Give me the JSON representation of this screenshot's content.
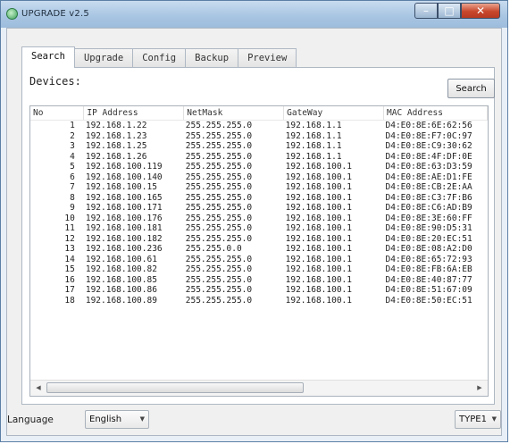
{
  "window": {
    "title": "UPGRADE v2.5",
    "minimize": "–",
    "maximize": "□",
    "close": "✕"
  },
  "tabs": [
    "Search",
    "Upgrade",
    "Config",
    "Backup",
    "Preview"
  ],
  "active_tab": "Search",
  "devices_label": "Devices:",
  "search_button": "Search",
  "table": {
    "columns": [
      "No",
      "IP Address",
      "NetMask",
      "GateWay",
      "MAC Address"
    ],
    "rows": [
      [
        "1",
        "192.168.1.22",
        "255.255.255.0",
        "192.168.1.1",
        "D4:E0:8E:6E:62:56"
      ],
      [
        "2",
        "192.168.1.23",
        "255.255.255.0",
        "192.168.1.1",
        "D4:E0:8E:F7:0C:97"
      ],
      [
        "3",
        "192.168.1.25",
        "255.255.255.0",
        "192.168.1.1",
        "D4:E0:8E:C9:30:62"
      ],
      [
        "4",
        "192.168.1.26",
        "255.255.255.0",
        "192.168.1.1",
        "D4:E0:8E:4F:DF:0E"
      ],
      [
        "5",
        "192.168.100.119",
        "255.255.255.0",
        "192.168.100.1",
        "D4:E0:8E:63:D3:59"
      ],
      [
        "6",
        "192.168.100.140",
        "255.255.255.0",
        "192.168.100.1",
        "D4:E0:8E:AE:D1:FE"
      ],
      [
        "7",
        "192.168.100.15",
        "255.255.255.0",
        "192.168.100.1",
        "D4:E0:8E:CB:2E:AA"
      ],
      [
        "8",
        "192.168.100.165",
        "255.255.255.0",
        "192.168.100.1",
        "D4:E0:8E:C3:7F:B6"
      ],
      [
        "9",
        "192.168.100.171",
        "255.255.255.0",
        "192.168.100.1",
        "D4:E0:8E:C6:AD:B9"
      ],
      [
        "10",
        "192.168.100.176",
        "255.255.255.0",
        "192.168.100.1",
        "D4:E0:8E:3E:60:FF"
      ],
      [
        "11",
        "192.168.100.181",
        "255.255.255.0",
        "192.168.100.1",
        "D4:E0:8E:90:D5:31"
      ],
      [
        "12",
        "192.168.100.182",
        "255.255.255.0",
        "192.168.100.1",
        "D4:E0:8E:20:EC:51"
      ],
      [
        "13",
        "192.168.100.236",
        "255.255.0.0",
        "192.168.100.1",
        "D4:E0:8E:08:A2:D0"
      ],
      [
        "14",
        "192.168.100.61",
        "255.255.255.0",
        "192.168.100.1",
        "D4:E0:8E:65:72:93"
      ],
      [
        "15",
        "192.168.100.82",
        "255.255.255.0",
        "192.168.100.1",
        "D4:E0:8E:FB:6A:EB"
      ],
      [
        "16",
        "192.168.100.85",
        "255.255.255.0",
        "192.168.100.1",
        "D4:E0:8E:40:87:77"
      ],
      [
        "17",
        "192.168.100.86",
        "255.255.255.0",
        "192.168.100.1",
        "D4:E0:8E:51:67:09"
      ],
      [
        "18",
        "192.168.100.89",
        "255.255.255.0",
        "192.168.100.1",
        "D4:E0:8E:50:EC:51"
      ]
    ]
  },
  "scrollbar": {
    "left_arrow": "◀",
    "right_arrow": "▶"
  },
  "language_label": "Language",
  "language_value": "English",
  "type_value": "TYPE1",
  "dropdown_caret": "▼",
  "colors": {
    "titlebar": "#a9c6e3",
    "close_button": "#c8472d",
    "panel_bg": "#ffffff",
    "window_bg": "#f0f0f0"
  }
}
